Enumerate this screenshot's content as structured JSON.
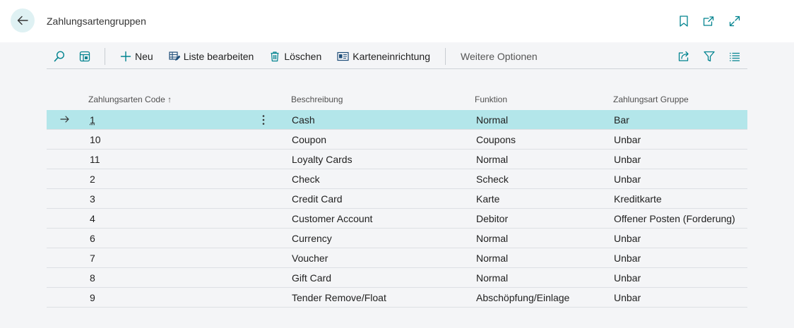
{
  "header": {
    "title": "Zahlungsartengruppen"
  },
  "toolbar": {
    "new_label": "Neu",
    "edit_list_label": "Liste bearbeiten",
    "delete_label": "Löschen",
    "card_setup_label": "Karteneinrichtung",
    "more_options_label": "Weitere Optionen"
  },
  "table": {
    "columns": {
      "code": "Zahlungsarten Code",
      "sort_indicator": "↑",
      "description": "Beschreibung",
      "function": "Funktion",
      "group": "Zahlungsart Gruppe"
    },
    "rows": [
      {
        "code": "1",
        "description": "Cash",
        "function": "Normal",
        "group": "Bar"
      },
      {
        "code": "10",
        "description": "Coupon",
        "function": "Coupons",
        "group": "Unbar"
      },
      {
        "code": "11",
        "description": "Loyalty Cards",
        "function": "Normal",
        "group": "Unbar"
      },
      {
        "code": "2",
        "description": "Check",
        "function": "Scheck",
        "group": "Unbar"
      },
      {
        "code": "3",
        "description": "Credit Card",
        "function": "Karte",
        "group": "Kreditkarte"
      },
      {
        "code": "4",
        "description": "Customer Account",
        "function": "Debitor",
        "group": "Offener Posten (Forderung)"
      },
      {
        "code": "6",
        "description": "Currency",
        "function": "Normal",
        "group": "Unbar"
      },
      {
        "code": "7",
        "description": "Voucher",
        "function": "Normal",
        "group": "Unbar"
      },
      {
        "code": "8",
        "description": "Gift Card",
        "function": "Normal",
        "group": "Unbar"
      },
      {
        "code": "9",
        "description": "Tender Remove/Float",
        "function": "Abschöpfung/Einlage",
        "group": "Unbar"
      }
    ]
  },
  "colors": {
    "accent": "#00838f",
    "selected_row": "#b3e6ea",
    "back_button_bg": "#dff1f3"
  }
}
